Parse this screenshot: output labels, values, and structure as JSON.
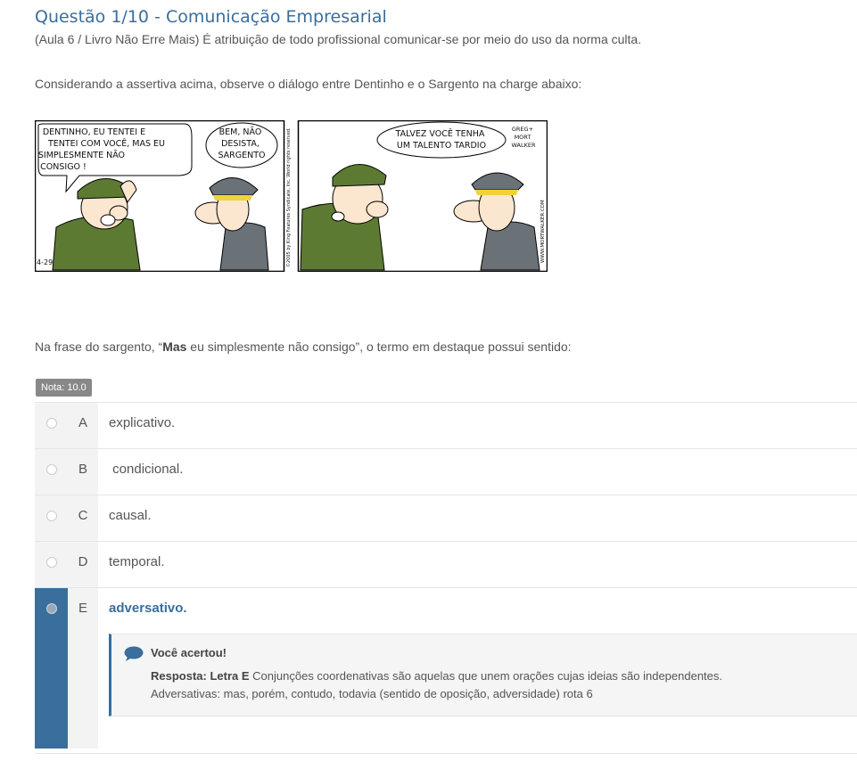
{
  "question": {
    "title": "Questão 1/10 - Comunicação Empresarial",
    "intro": "(Aula 6 / Livro Não Erre Mais) É atribuição de todo profissional comunicar-se por meio do uso da norma culta.",
    "consider": "Considerando a assertiva acima, observe o diálogo entre Dentinho e o Sargento na charge abaixo:",
    "prompt_before": "Na frase do sargento, “",
    "prompt_bold": "Mas",
    "prompt_after": " eu simplesmente não consigo”, o termo em destaque possui sentido:"
  },
  "comic": {
    "panel1_bubble": [
      "DENTINHO, EU TENTEI E",
      "TENTEI COM VOCÊ, MAS EU",
      "SIMPLESMENTE NÃO",
      "CONSIGO !"
    ],
    "panel1_bubble2": [
      "BEM, NÃO",
      "DESISTA,",
      "SARGENTO"
    ],
    "panel1_date": "4-29",
    "panel1_copyright": "©2005 by King Features Syndicate, Inc. World rights reserved.",
    "panel2_bubble": [
      "TALVEZ VOCÊ TENHA",
      "UM TALENTO TARDIO"
    ],
    "signature": [
      "GREG+",
      "MORT",
      "WALKER"
    ],
    "website": "WWW.MORTWALKER.COM"
  },
  "grade": "Nota: 10.0",
  "options": [
    {
      "letter": "A",
      "text": "explicativo."
    },
    {
      "letter": "B",
      "text": " condicional."
    },
    {
      "letter": "C",
      "text": "causal."
    },
    {
      "letter": "D",
      "text": "temporal."
    },
    {
      "letter": "E",
      "text": "adversativo."
    }
  ],
  "feedback": {
    "title": "Você acertou!",
    "answer_label": "Resposta: Letra E",
    "line1": " Conjunções coordenativas são aquelas que unem orações cujas ideias são independentes.",
    "line2": "Adversativas: mas, porém, contudo, todavia (sentido de oposição, adversidade) rota 6"
  },
  "colors": {
    "accent": "#3a6e9c",
    "text": "#555555",
    "badge": "#888888",
    "option_bg": "#f3f3f3",
    "feedback_bg": "#f5f5f5"
  }
}
